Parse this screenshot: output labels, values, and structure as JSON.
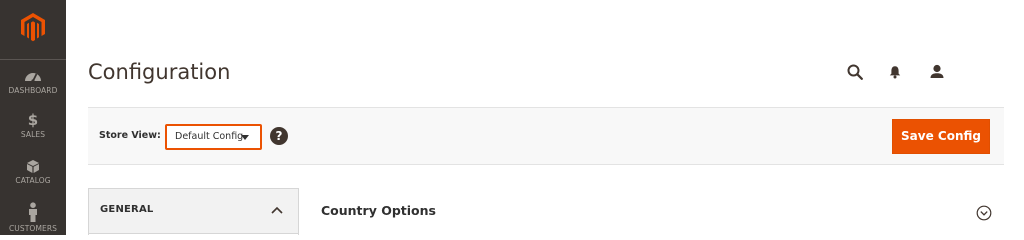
{
  "sidebar": {
    "items": [
      {
        "label": "DASHBOARD",
        "icon": "dashboard-icon"
      },
      {
        "label": "SALES",
        "icon": "dollar-icon"
      },
      {
        "label": "CATALOG",
        "icon": "box-icon"
      },
      {
        "label": "CUSTOMERS",
        "icon": "person-icon"
      }
    ],
    "logo_icon": "magento-logo"
  },
  "header": {
    "title": "Configuration",
    "icons": [
      "search-icon",
      "bell-icon",
      "user-icon"
    ]
  },
  "toolbar": {
    "store_view_label": "Store View:",
    "store_view_value": "Default Config",
    "help_label": "?",
    "save_label": "Save Config"
  },
  "tabs": {
    "general_label": "GENERAL"
  },
  "section": {
    "title": "Country Options"
  },
  "colors": {
    "sidebar_bg": "#373330",
    "accent": "#eb5202",
    "text": "#41362f"
  }
}
